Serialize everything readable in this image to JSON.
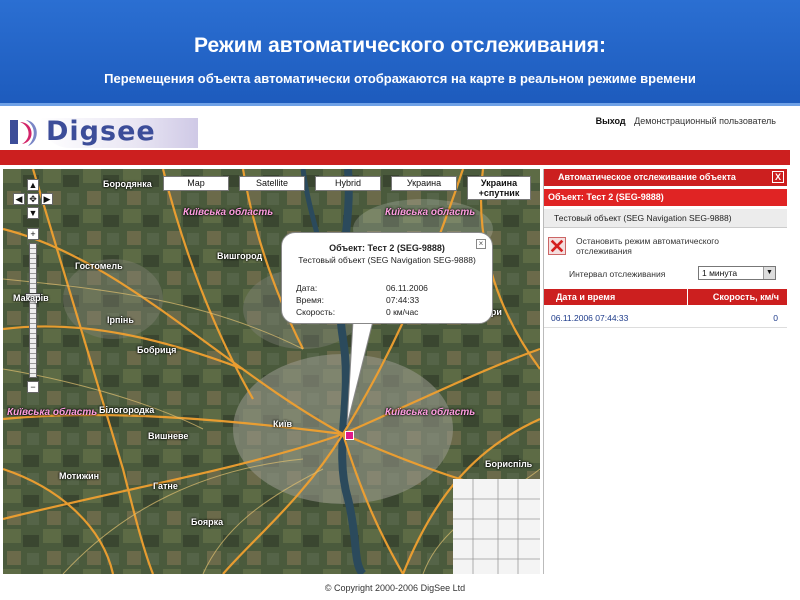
{
  "banner": {
    "title": "Режим автоматического отслеживания:",
    "subtitle": "Перемещения объекта автоматически отображаются на карте в реальном режиме времени"
  },
  "header": {
    "logo_text": "Digsee",
    "logout": "Выход",
    "user": "Демонстрационный пользователь"
  },
  "map": {
    "types": [
      "Map",
      "Satellite",
      "Hybrid",
      "Украина"
    ],
    "active_type_line1": "Украина",
    "active_type_line2": "+спутник",
    "places": {
      "borodyanka": "Бородянка",
      "vyshgorod": "Вишгород",
      "gostomel": "Гостомель",
      "irpin": "Ірпінь",
      "borova": "Бобриця",
      "kyiv": "Київ",
      "vyshneve": "Вишневе",
      "borispil": "Бориспіль",
      "brovary": "Бровари",
      "bilhorodka": "Білогородка",
      "boyarka": "Боярка",
      "makariv": "Макарів",
      "hatne": "Гатне",
      "motyzhyn": "Мотижин"
    },
    "regions": {
      "r1": "Київська область",
      "r2": "Київська область",
      "r3": "Київська область",
      "r4": "Київська область"
    },
    "accent": "#e01a8a"
  },
  "popup": {
    "title": "Объект: Тест 2 (SEG-9888)",
    "description": "Тестовый объект (SEG Navigation SEG-9888)",
    "date_label": "Дата:",
    "date_value": "06.11.2006",
    "time_label": "Время:",
    "time_value": "07:44:33",
    "speed_label": "Скорость:",
    "speed_value": "0 км/час"
  },
  "panel": {
    "title": "Автоматическое отслеживание объекта",
    "close": "X",
    "object_header": "Объект: Тест 2 (SEG-9888)",
    "object_row": "Тестовый объект (SEG Navigation SEG-9888)",
    "stop_text": "Остановить режим автоматического отслеживания",
    "interval_label": "Интервал отслеживания",
    "interval_value": "1 минута",
    "table": {
      "col_date": "Дата и время",
      "col_speed": "Скорость, км/ч",
      "rows": [
        {
          "datetime": "06.11.2006 07:44:33",
          "speed": "0"
        }
      ]
    }
  },
  "footer": {
    "copyright": "© Copyright 2000-2006 DigSee Ltd"
  },
  "colors": {
    "banner": "#1d5bbd",
    "red": "#cc1f1f",
    "logo": "#3c4d99"
  }
}
